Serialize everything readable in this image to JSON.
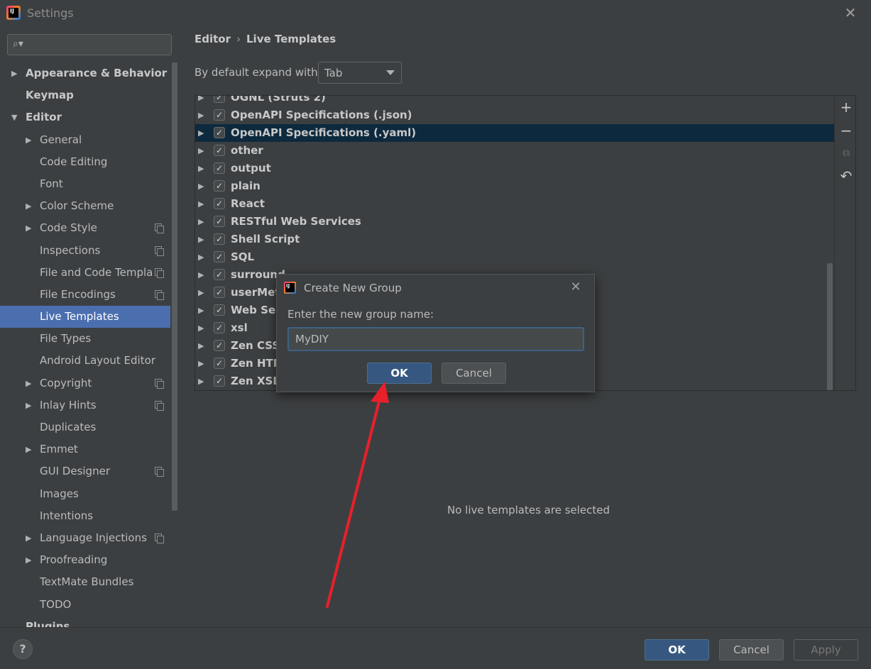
{
  "window": {
    "title": "Settings",
    "close_glyph": "✕"
  },
  "search": {
    "placeholder": "",
    "icon": "search-icon"
  },
  "sidebar": {
    "items": [
      {
        "label": "Appearance & Behavior",
        "arrow": "▶",
        "copy": false
      },
      {
        "label": "Keymap",
        "arrow": "",
        "copy": false
      },
      {
        "label": "Editor",
        "arrow": "▼",
        "copy": false
      },
      {
        "label": "General",
        "arrow": "▶",
        "copy": false
      },
      {
        "label": "Code Editing",
        "arrow": "",
        "copy": false
      },
      {
        "label": "Font",
        "arrow": "",
        "copy": false
      },
      {
        "label": "Color Scheme",
        "arrow": "▶",
        "copy": false
      },
      {
        "label": "Code Style",
        "arrow": "▶",
        "copy": true
      },
      {
        "label": "Inspections",
        "arrow": "",
        "copy": true
      },
      {
        "label": "File and Code Templa",
        "arrow": "",
        "copy": true
      },
      {
        "label": "File Encodings",
        "arrow": "",
        "copy": true
      },
      {
        "label": "Live Templates",
        "arrow": "",
        "copy": false
      },
      {
        "label": "File Types",
        "arrow": "",
        "copy": false
      },
      {
        "label": "Android Layout Editor",
        "arrow": "",
        "copy": false
      },
      {
        "label": "Copyright",
        "arrow": "▶",
        "copy": true
      },
      {
        "label": "Inlay Hints",
        "arrow": "▶",
        "copy": true
      },
      {
        "label": "Duplicates",
        "arrow": "",
        "copy": false
      },
      {
        "label": "Emmet",
        "arrow": "▶",
        "copy": false
      },
      {
        "label": "GUI Designer",
        "arrow": "",
        "copy": true
      },
      {
        "label": "Images",
        "arrow": "",
        "copy": false
      },
      {
        "label": "Intentions",
        "arrow": "",
        "copy": false
      },
      {
        "label": "Language Injections",
        "arrow": "▶",
        "copy": true
      },
      {
        "label": "Proofreading",
        "arrow": "▶",
        "copy": false
      },
      {
        "label": "TextMate Bundles",
        "arrow": "",
        "copy": false
      },
      {
        "label": "TODO",
        "arrow": "",
        "copy": false
      },
      {
        "label": "Plugins",
        "arrow": "",
        "copy": false
      }
    ]
  },
  "breadcrumb": {
    "parent": "Editor",
    "separator": "›",
    "current": "Live Templates"
  },
  "expand": {
    "label": "By default expand with",
    "value": "Tab"
  },
  "template_groups": [
    {
      "label": "OGNL (Struts 2)",
      "checked": true
    },
    {
      "label": "OpenAPI Specifications (.json)",
      "checked": true
    },
    {
      "label": "OpenAPI Specifications (.yaml)",
      "checked": true
    },
    {
      "label": "other",
      "checked": true
    },
    {
      "label": "output",
      "checked": true
    },
    {
      "label": "plain",
      "checked": true
    },
    {
      "label": "React",
      "checked": true
    },
    {
      "label": "RESTful Web Services",
      "checked": true
    },
    {
      "label": "Shell Script",
      "checked": true
    },
    {
      "label": "SQL",
      "checked": true
    },
    {
      "label": "surround",
      "checked": true
    },
    {
      "label": "userMeth",
      "checked": true
    },
    {
      "label": "Web Ser",
      "checked": true
    },
    {
      "label": "xsl",
      "checked": true
    },
    {
      "label": "Zen CSS",
      "checked": true
    },
    {
      "label": "Zen HTM",
      "checked": true
    },
    {
      "label": "Zen XSL",
      "checked": true
    }
  ],
  "toolbar": {
    "add": "+",
    "remove": "−",
    "copy": "⧉",
    "revert": "↶"
  },
  "empty_message": "No live templates are selected",
  "dialog": {
    "title": "Create New Group",
    "prompt": "Enter the new group name:",
    "value": "MyDIY",
    "ok": "OK",
    "cancel": "Cancel",
    "close_glyph": "✕"
  },
  "footer": {
    "help": "?",
    "ok": "OK",
    "cancel": "Cancel",
    "apply": "Apply"
  },
  "colors": {
    "accent": "#4b6eaf",
    "primary_button": "#365880",
    "annotation_arrow": "#e8202a"
  }
}
